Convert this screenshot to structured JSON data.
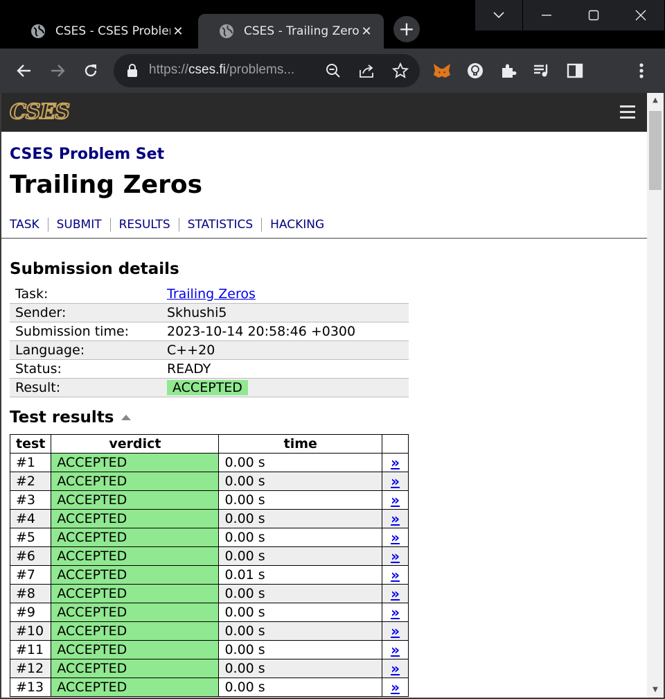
{
  "browser": {
    "tabs": [
      {
        "title": "CSES - CSES Problem Set",
        "active": false
      },
      {
        "title": "CSES - Trailing Zeros",
        "active": true
      }
    ],
    "close_glyph": "✕",
    "new_tab_glyph": "+",
    "window_controls": {
      "tab_search": "⌵",
      "minimize": "—",
      "maximize": "☐",
      "close": "✕"
    },
    "url_scheme": "https://",
    "url_host": "cses.fi",
    "url_path": "/problems..."
  },
  "site": {
    "logo": "CSES",
    "section_title": "CSES Problem Set",
    "page_title": "Trailing Zeros",
    "nav": [
      "TASK",
      "SUBMIT",
      "RESULTS",
      "STATISTICS",
      "HACKING"
    ]
  },
  "submission": {
    "heading": "Submission details",
    "rows": [
      {
        "key": "Task:",
        "value": "Trailing Zeros",
        "type": "link"
      },
      {
        "key": "Sender:",
        "value": "Skhushi5",
        "type": "text"
      },
      {
        "key": "Submission time:",
        "value": "2023-10-14 20:58:46 +0300",
        "type": "text"
      },
      {
        "key": "Language:",
        "value": "C++20",
        "type": "text"
      },
      {
        "key": "Status:",
        "value": "READY",
        "type": "text"
      },
      {
        "key": "Result:",
        "value": "ACCEPTED",
        "type": "badge"
      }
    ]
  },
  "tests": {
    "heading": "Test results",
    "columns": [
      "test",
      "verdict",
      "time",
      ""
    ],
    "link_glyph": "»",
    "rows": [
      {
        "test": "#1",
        "verdict": "ACCEPTED",
        "time": "0.00 s"
      },
      {
        "test": "#2",
        "verdict": "ACCEPTED",
        "time": "0.00 s"
      },
      {
        "test": "#3",
        "verdict": "ACCEPTED",
        "time": "0.00 s"
      },
      {
        "test": "#4",
        "verdict": "ACCEPTED",
        "time": "0.00 s"
      },
      {
        "test": "#5",
        "verdict": "ACCEPTED",
        "time": "0.00 s"
      },
      {
        "test": "#6",
        "verdict": "ACCEPTED",
        "time": "0.00 s"
      },
      {
        "test": "#7",
        "verdict": "ACCEPTED",
        "time": "0.01 s"
      },
      {
        "test": "#8",
        "verdict": "ACCEPTED",
        "time": "0.00 s"
      },
      {
        "test": "#9",
        "verdict": "ACCEPTED",
        "time": "0.00 s"
      },
      {
        "test": "#10",
        "verdict": "ACCEPTED",
        "time": "0.00 s"
      },
      {
        "test": "#11",
        "verdict": "ACCEPTED",
        "time": "0.00 s"
      },
      {
        "test": "#12",
        "verdict": "ACCEPTED",
        "time": "0.00 s"
      },
      {
        "test": "#13",
        "verdict": "ACCEPTED",
        "time": "0.00 s"
      }
    ]
  },
  "colors": {
    "accepted_bg": "#90e890",
    "nav_link": "#000080",
    "link": "#0000ee",
    "logo_gold": "#c8a45a",
    "header_bg": "#2a2a2a"
  }
}
